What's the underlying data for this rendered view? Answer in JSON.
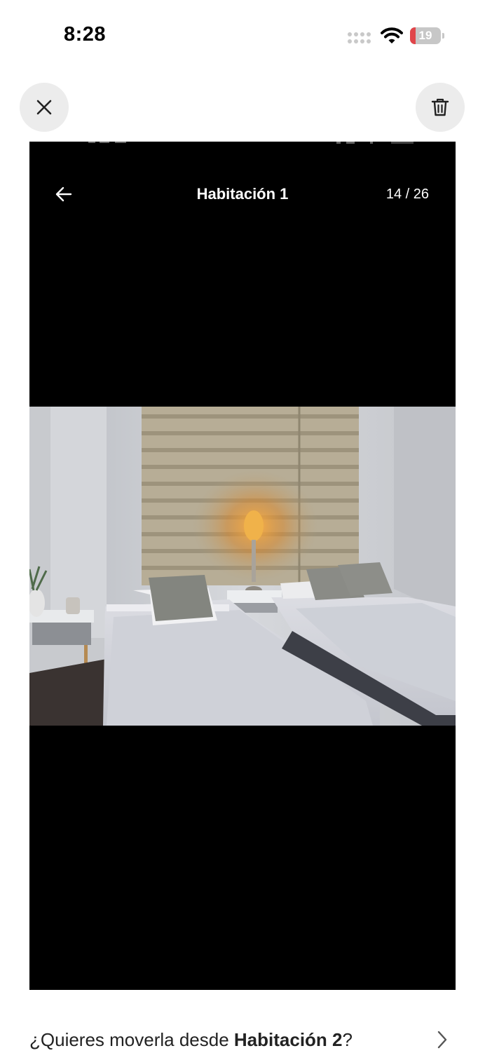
{
  "status_bar": {
    "time": "8:28",
    "battery_level": "19",
    "battery_fraction": 0.19
  },
  "icons": {
    "close": "close-icon",
    "delete": "trash-icon",
    "back": "arrow-left-icon",
    "wifi": "wifi-icon",
    "signal": "cellular-signal-icon",
    "battery": "battery-icon",
    "chevron": "chevron-right-icon"
  },
  "screenshot": {
    "title": "Habitación 1",
    "counter": "14 / 26"
  },
  "move_prompt": {
    "prefix": "¿Quieres moverla desde ",
    "room": "Habitación 2",
    "suffix": "?"
  },
  "colors": {
    "button_bg": "#ececec",
    "battery_low": "#e0454a",
    "photo_bg": "#000000"
  }
}
